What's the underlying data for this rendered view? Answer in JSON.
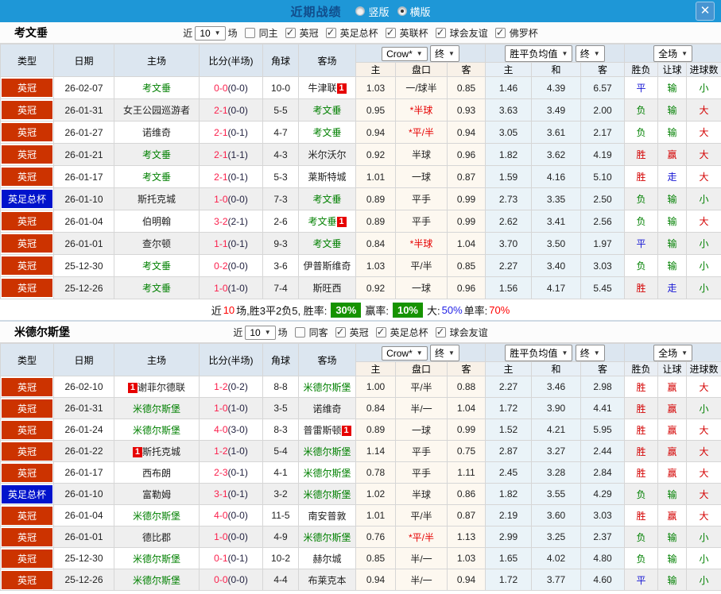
{
  "topbar": {
    "title": "近期战绩",
    "radios": [
      {
        "label": "竖版",
        "checked": false
      },
      {
        "label": "横版",
        "checked": true
      }
    ],
    "close_label": "✕"
  },
  "colors": {
    "league_colors": {
      "英冠": "#cc3300",
      "英足总杯": "#0013cc"
    },
    "topbar_blue": "#1e97d7",
    "summary_box_green": "#169300"
  },
  "header": {
    "cols": [
      "类型",
      "日期",
      "主场",
      "比分(半场)",
      "角球",
      "客场"
    ],
    "sub": [
      "主",
      "盘口",
      "客",
      "主",
      "和",
      "客",
      "胜负",
      "让球",
      "进球数"
    ],
    "selects": {
      "company": "Crow*",
      "company_stage": "终",
      "mean": "胜平负均值",
      "mean_stage": "终",
      "scope": "全场"
    }
  },
  "sections": [
    {
      "team": "考文垂",
      "filter": {
        "near_label": "近",
        "count": "10",
        "unit_label": "场",
        "checkboxes": [
          {
            "label": "同主",
            "checked": false
          },
          {
            "label": "英冠",
            "checked": true
          },
          {
            "label": "英足总杯",
            "checked": true
          },
          {
            "label": "英联杯",
            "checked": true
          },
          {
            "label": "球会友谊",
            "checked": true
          },
          {
            "label": "佛罗杯",
            "checked": true
          }
        ]
      },
      "rows": [
        {
          "type": "英冠",
          "date": "26-02-07",
          "home": {
            "name": "考文垂",
            "green": true
          },
          "score": "0-0",
          "half": "(0-0)",
          "corner": "10-0",
          "away": {
            "name": "牛津联",
            "badge": "1",
            "badge_pos": "after"
          },
          "odds": [
            "1.03",
            "一/球半",
            "0.85"
          ],
          "mean": [
            "1.46",
            "4.39",
            "6.57"
          ],
          "results": [
            "平",
            "输",
            "小"
          ]
        },
        {
          "type": "英冠",
          "date": "26-01-31",
          "home": {
            "name": "女王公园巡游者"
          },
          "score": "2-1",
          "half": "(0-0)",
          "corner": "5-5",
          "away": {
            "name": "考文垂",
            "green": true
          },
          "odds": [
            "0.95",
            "*半球",
            "0.93"
          ],
          "mean": [
            "3.63",
            "3.49",
            "2.00"
          ],
          "results": [
            "负",
            "输",
            "大"
          ]
        },
        {
          "type": "英冠",
          "date": "26-01-27",
          "home": {
            "name": "诺维奇"
          },
          "score": "2-1",
          "half": "(0-1)",
          "corner": "4-7",
          "away": {
            "name": "考文垂",
            "green": true
          },
          "odds": [
            "0.94",
            "*平/半",
            "0.94"
          ],
          "mean": [
            "3.05",
            "3.61",
            "2.17"
          ],
          "results": [
            "负",
            "输",
            "大"
          ]
        },
        {
          "type": "英冠",
          "date": "26-01-21",
          "home": {
            "name": "考文垂",
            "green": true
          },
          "score": "2-1",
          "half": "(1-1)",
          "corner": "4-3",
          "away": {
            "name": "米尔沃尔"
          },
          "odds": [
            "0.92",
            "半球",
            "0.96"
          ],
          "mean": [
            "1.82",
            "3.62",
            "4.19"
          ],
          "results": [
            "胜",
            "赢",
            "大"
          ]
        },
        {
          "type": "英冠",
          "date": "26-01-17",
          "home": {
            "name": "考文垂",
            "green": true
          },
          "score": "2-1",
          "half": "(0-1)",
          "corner": "5-3",
          "away": {
            "name": "莱斯特城"
          },
          "odds": [
            "1.01",
            "一球",
            "0.87"
          ],
          "mean": [
            "1.59",
            "4.16",
            "5.10"
          ],
          "results": [
            "胜",
            "走",
            "大"
          ]
        },
        {
          "type": "英足总杯",
          "date": "26-01-10",
          "home": {
            "name": "斯托克城"
          },
          "score": "1-0",
          "half": "(0-0)",
          "corner": "7-3",
          "away": {
            "name": "考文垂",
            "green": true
          },
          "odds": [
            "0.89",
            "平手",
            "0.99"
          ],
          "mean": [
            "2.73",
            "3.35",
            "2.50"
          ],
          "results": [
            "负",
            "输",
            "小"
          ]
        },
        {
          "type": "英冠",
          "date": "26-01-04",
          "home": {
            "name": "伯明翰"
          },
          "score": "3-2",
          "half": "(2-1)",
          "corner": "2-6",
          "away": {
            "name": "考文垂",
            "green": true,
            "badge": "1",
            "badge_pos": "after"
          },
          "odds": [
            "0.89",
            "平手",
            "0.99"
          ],
          "mean": [
            "2.62",
            "3.41",
            "2.56"
          ],
          "results": [
            "负",
            "输",
            "大"
          ]
        },
        {
          "type": "英冠",
          "date": "26-01-01",
          "home": {
            "name": "查尔顿"
          },
          "score": "1-1",
          "half": "(0-1)",
          "corner": "9-3",
          "away": {
            "name": "考文垂",
            "green": true
          },
          "odds": [
            "0.84",
            "*半球",
            "1.04"
          ],
          "mean": [
            "3.70",
            "3.50",
            "1.97"
          ],
          "results": [
            "平",
            "输",
            "小"
          ]
        },
        {
          "type": "英冠",
          "date": "25-12-30",
          "home": {
            "name": "考文垂",
            "green": true
          },
          "score": "0-2",
          "half": "(0-0)",
          "corner": "3-6",
          "away": {
            "name": "伊普斯维奇"
          },
          "odds": [
            "1.03",
            "平/半",
            "0.85"
          ],
          "mean": [
            "2.27",
            "3.40",
            "3.03"
          ],
          "results": [
            "负",
            "输",
            "小"
          ]
        },
        {
          "type": "英冠",
          "date": "25-12-26",
          "home": {
            "name": "考文垂",
            "green": true
          },
          "score": "1-0",
          "half": "(1-0)",
          "corner": "7-4",
          "away": {
            "name": "斯旺西"
          },
          "odds": [
            "0.92",
            "一球",
            "0.96"
          ],
          "mean": [
            "1.56",
            "4.17",
            "5.45"
          ],
          "results": [
            "胜",
            "走",
            "小"
          ]
        }
      ],
      "summary": [
        {
          "text": "近"
        },
        {
          "text": "10",
          "color": "red"
        },
        {
          "text": "场,胜3平2负5, 胜率:"
        },
        {
          "box": "30%"
        },
        {
          "text": "赢率:"
        },
        {
          "box": "10%"
        },
        {
          "text": "大:"
        },
        {
          "text": "50%",
          "color": "blue"
        },
        {
          "text": " 单率:"
        },
        {
          "text": "70%",
          "color": "red"
        }
      ]
    },
    {
      "team": "米德尔斯堡",
      "filter": {
        "near_label": "近",
        "count": "10",
        "unit_label": "场",
        "checkboxes": [
          {
            "label": "同客",
            "checked": false
          },
          {
            "label": "英冠",
            "checked": true
          },
          {
            "label": "英足总杯",
            "checked": true
          },
          {
            "label": "球会友谊",
            "checked": true
          }
        ]
      },
      "rows": [
        {
          "type": "英冠",
          "date": "26-02-10",
          "home": {
            "name": "谢菲尔德联",
            "badge": "1",
            "badge_pos": "before"
          },
          "score": "1-2",
          "half": "(0-2)",
          "corner": "8-8",
          "away": {
            "name": "米德尔斯堡",
            "green": true
          },
          "odds": [
            "1.00",
            "平/半",
            "0.88"
          ],
          "mean": [
            "2.27",
            "3.46",
            "2.98"
          ],
          "results": [
            "胜",
            "赢",
            "大"
          ]
        },
        {
          "type": "英冠",
          "date": "26-01-31",
          "home": {
            "name": "米德尔斯堡",
            "green": true
          },
          "score": "1-0",
          "half": "(1-0)",
          "corner": "3-5",
          "away": {
            "name": "诺维奇"
          },
          "odds": [
            "0.84",
            "半/一",
            "1.04"
          ],
          "mean": [
            "1.72",
            "3.90",
            "4.41"
          ],
          "results": [
            "胜",
            "赢",
            "小"
          ]
        },
        {
          "type": "英冠",
          "date": "26-01-24",
          "home": {
            "name": "米德尔斯堡",
            "green": true
          },
          "score": "4-0",
          "half": "(3-0)",
          "corner": "8-3",
          "away": {
            "name": "普雷斯顿",
            "badge": "1",
            "badge_pos": "after"
          },
          "odds": [
            "0.89",
            "一球",
            "0.99"
          ],
          "mean": [
            "1.52",
            "4.21",
            "5.95"
          ],
          "results": [
            "胜",
            "赢",
            "大"
          ]
        },
        {
          "type": "英冠",
          "date": "26-01-22",
          "home": {
            "name": "斯托克城",
            "badge": "1",
            "badge_pos": "before"
          },
          "score": "1-2",
          "half": "(1-0)",
          "corner": "5-4",
          "away": {
            "name": "米德尔斯堡",
            "green": true
          },
          "odds": [
            "1.14",
            "平手",
            "0.75"
          ],
          "mean": [
            "2.87",
            "3.27",
            "2.44"
          ],
          "results": [
            "胜",
            "赢",
            "大"
          ]
        },
        {
          "type": "英冠",
          "date": "26-01-17",
          "home": {
            "name": "西布朗"
          },
          "score": "2-3",
          "half": "(0-1)",
          "corner": "4-1",
          "away": {
            "name": "米德尔斯堡",
            "green": true
          },
          "odds": [
            "0.78",
            "平手",
            "1.11"
          ],
          "mean": [
            "2.45",
            "3.28",
            "2.84"
          ],
          "results": [
            "胜",
            "赢",
            "大"
          ]
        },
        {
          "type": "英足总杯",
          "date": "26-01-10",
          "home": {
            "name": "富勒姆"
          },
          "score": "3-1",
          "half": "(0-1)",
          "corner": "3-2",
          "away": {
            "name": "米德尔斯堡",
            "green": true
          },
          "odds": [
            "1.02",
            "半球",
            "0.86"
          ],
          "mean": [
            "1.82",
            "3.55",
            "4.29"
          ],
          "results": [
            "负",
            "输",
            "大"
          ]
        },
        {
          "type": "英冠",
          "date": "26-01-04",
          "home": {
            "name": "米德尔斯堡",
            "green": true
          },
          "score": "4-0",
          "half": "(0-0)",
          "corner": "11-5",
          "away": {
            "name": "南安普敦"
          },
          "odds": [
            "1.01",
            "平/半",
            "0.87"
          ],
          "mean": [
            "2.19",
            "3.60",
            "3.03"
          ],
          "results": [
            "胜",
            "赢",
            "大"
          ]
        },
        {
          "type": "英冠",
          "date": "26-01-01",
          "home": {
            "name": "德比郡"
          },
          "score": "1-0",
          "half": "(0-0)",
          "corner": "4-9",
          "away": {
            "name": "米德尔斯堡",
            "green": true
          },
          "odds": [
            "0.76",
            "*平/半",
            "1.13"
          ],
          "mean": [
            "2.99",
            "3.25",
            "2.37"
          ],
          "results": [
            "负",
            "输",
            "小"
          ]
        },
        {
          "type": "英冠",
          "date": "25-12-30",
          "home": {
            "name": "米德尔斯堡",
            "green": true
          },
          "score": "0-1",
          "half": "(0-1)",
          "corner": "10-2",
          "away": {
            "name": "赫尔城"
          },
          "odds": [
            "0.85",
            "半/一",
            "1.03"
          ],
          "mean": [
            "1.65",
            "4.02",
            "4.80"
          ],
          "results": [
            "负",
            "输",
            "小"
          ]
        },
        {
          "type": "英冠",
          "date": "25-12-26",
          "home": {
            "name": "米德尔斯堡",
            "green": true
          },
          "score": "0-0",
          "half": "(0-0)",
          "corner": "4-4",
          "away": {
            "name": "布莱克本"
          },
          "odds": [
            "0.94",
            "半/一",
            "0.94"
          ],
          "mean": [
            "1.72",
            "3.77",
            "4.60"
          ],
          "results": [
            "平",
            "输",
            "小"
          ]
        }
      ]
    }
  ]
}
